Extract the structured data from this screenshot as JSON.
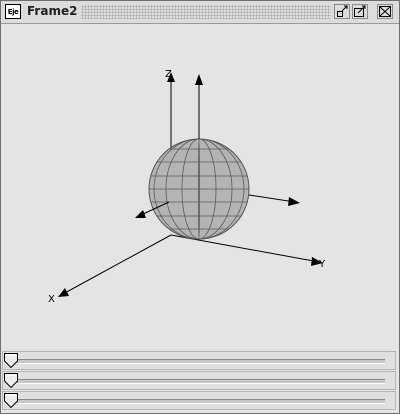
{
  "window": {
    "title": "Frame2",
    "icon_text": "Eje",
    "icons": [
      "app-icon",
      "minimize-icon",
      "maximize-icon",
      "close-icon"
    ]
  },
  "scene": {
    "axes": [
      {
        "label": "Z"
      },
      {
        "label": "Y"
      },
      {
        "label": "X"
      }
    ],
    "sphere_color": "#b4b4b4"
  },
  "sliders": [
    {
      "value": 0
    },
    {
      "value": 0
    },
    {
      "value": 0
    }
  ]
}
